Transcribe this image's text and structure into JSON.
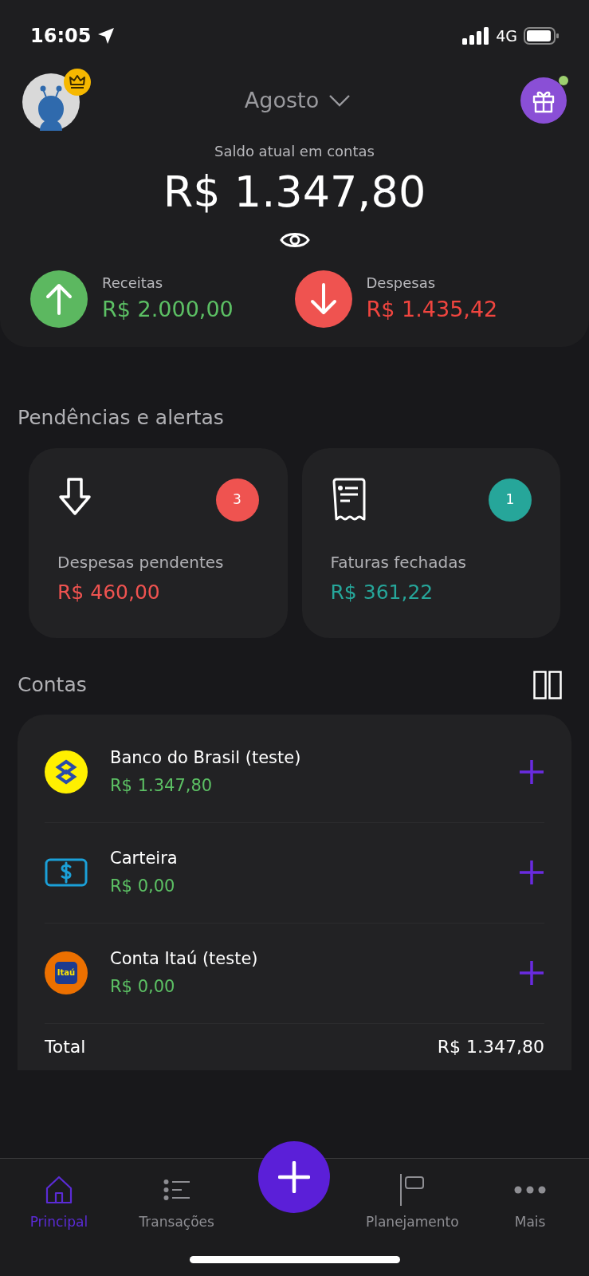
{
  "status_bar": {
    "time": "16:05",
    "network": "4G"
  },
  "header": {
    "month": "Agosto"
  },
  "balance": {
    "label": "Saldo atual em contas",
    "amount": "R$ 1.347,80"
  },
  "summary": [
    {
      "kind": "income",
      "label": "Receitas",
      "amount": "R$ 2.000,00"
    },
    {
      "kind": "expense",
      "label": "Despesas",
      "amount": "R$ 1.435,42"
    }
  ],
  "alerts": {
    "title": "Pendências e alertas",
    "items": [
      {
        "kind": "pending",
        "label": "Despesas pendentes",
        "amount": "R$ 460,00",
        "count": "3",
        "color": "#ef5350"
      },
      {
        "kind": "invoice",
        "label": "Faturas fechadas",
        "amount": "R$ 361,22",
        "count": "1",
        "color": "#26a69a"
      }
    ]
  },
  "accounts": {
    "title": "Contas",
    "items": [
      {
        "kind": "bb",
        "name": "Banco do Brasil (teste)",
        "balance": "R$ 1.347,80"
      },
      {
        "kind": "wallet",
        "name": "Carteira",
        "balance": "R$ 0,00"
      },
      {
        "kind": "itau",
        "name": "Conta Itaú (teste)",
        "balance": "R$ 0,00",
        "logo_text": "Itaú"
      }
    ],
    "total": {
      "label": "Total",
      "amount": "R$ 1.347,80"
    }
  },
  "nav": [
    {
      "kind": "home",
      "label": "Principal",
      "selected": true
    },
    {
      "kind": "list",
      "label": "Transações",
      "selected": false
    },
    {
      "kind": "add"
    },
    {
      "kind": "flag",
      "label": "Planejamento",
      "selected": false
    },
    {
      "kind": "more",
      "label": "Mais",
      "selected": false
    }
  ]
}
